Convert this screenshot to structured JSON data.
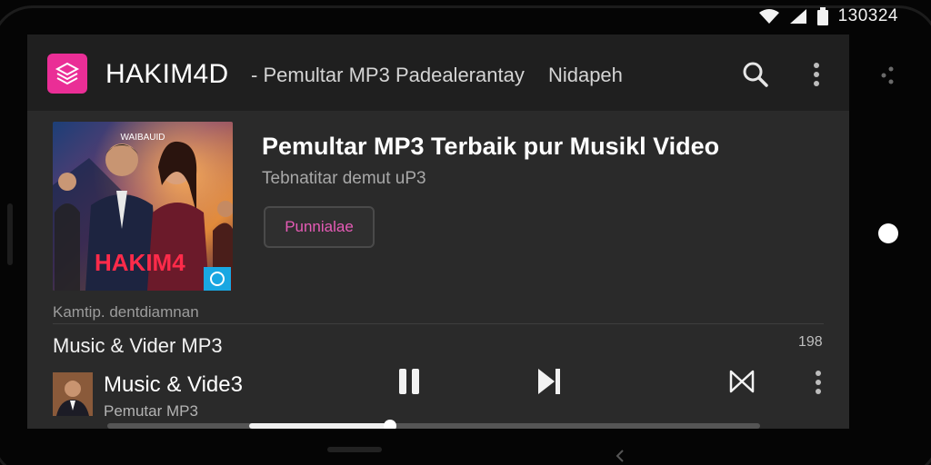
{
  "status_bar": {
    "time": "130324",
    "icons": [
      "wifi-icon",
      "signal-icon",
      "battery-icon"
    ]
  },
  "app_bar": {
    "title": "HAKIM4D",
    "separator": "-",
    "subtitle": "Pemultar MP3 Padealerantay",
    "extra": "Nidapeh",
    "icons": [
      "app-logo-icon",
      "search-icon",
      "more-vert-icon"
    ]
  },
  "featured": {
    "album_banner": "WAIBAUID",
    "album_label": "HAKIM4",
    "title": "Pemultar MP3 Terbaik pur Musikl Video",
    "subtitle": "Tebnatitar demut uP3",
    "button_label": "Punnialae",
    "caption": "Kamtip. dentdiamnan"
  },
  "section": {
    "title": "Music & Vider MP3",
    "count": "198"
  },
  "now_playing": {
    "title": "Music & Vide3",
    "artist": "Pemutar MP3",
    "progress": 0.275,
    "controls": [
      "pause-icon",
      "skip-next-icon",
      "shuffle-icon",
      "more-vert-icon"
    ]
  },
  "colors": {
    "accent": "#ea2e96",
    "button_text": "#e65bb6",
    "background": "#2a2a2a",
    "app_bar": "#1f1f1f"
  }
}
